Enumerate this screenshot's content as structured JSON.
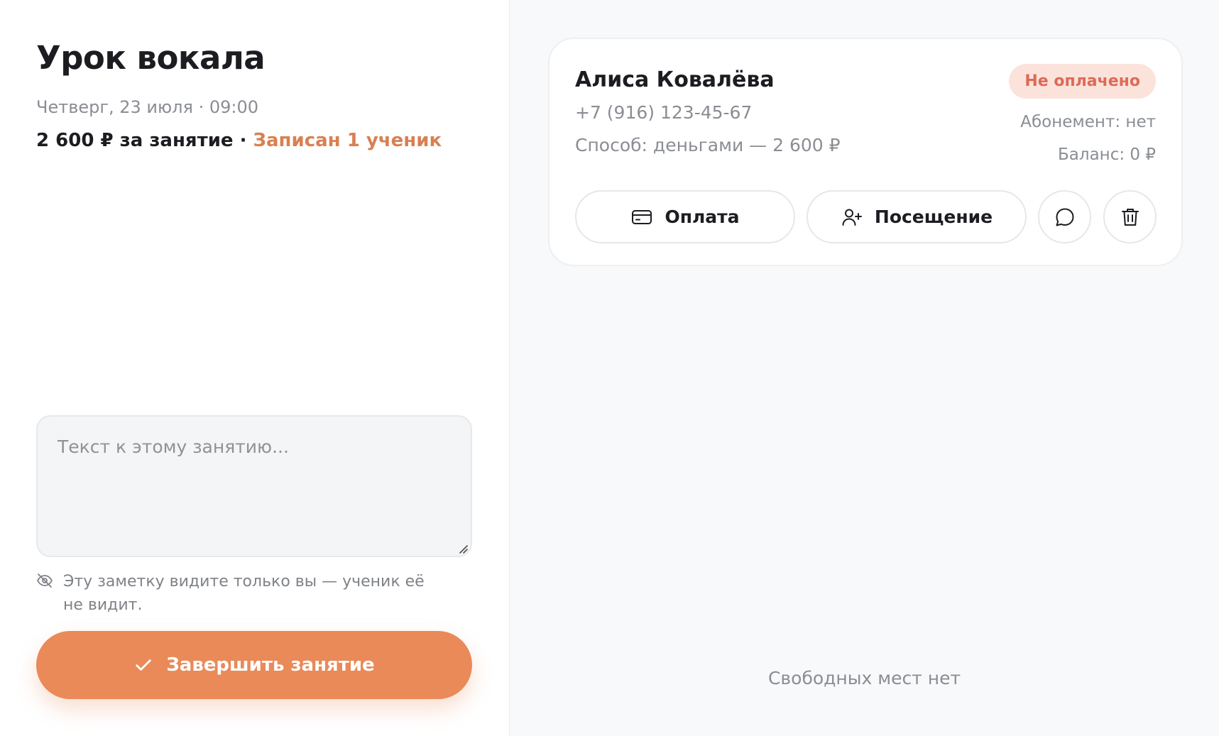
{
  "lesson": {
    "title": "Урок вокала",
    "subtitle": "Четверг, 23 июля · 09:00",
    "price": "2 600 ₽ за занятие",
    "separator": " · ",
    "enrolled": "Записан 1 ученик"
  },
  "note": {
    "value": "",
    "placeholder": "Текст к этому занятию...",
    "hint": "Эту заметку видите только вы — ученик её не видит."
  },
  "finish_button": {
    "label": "Завершить занятие",
    "icon": "check-icon"
  },
  "student_card": {
    "name": "Алиса Ковалёва",
    "phone": "+7 (916) 123-45-67",
    "method": "Способ: деньгами — 2 600 ₽",
    "status": "Не оплачено",
    "subscription": "Абонемент: нет",
    "balance": "Баланс: 0 ₽",
    "actions": {
      "pay_label": "Оплата",
      "pay_icon": "credit-card-icon",
      "visit_label": "Посещение",
      "visit_icon": "user-plus-icon",
      "chat_icon": "chat-bubble-icon",
      "delete_icon": "trash-icon"
    }
  },
  "footer": {
    "no_seats": "Свободных мест нет"
  },
  "colors": {
    "accent": "#e98a58",
    "accent_text": "#d98051",
    "status_bg": "#fbe3dc",
    "status_text": "#de6a56",
    "muted_text": "#8a8d93",
    "right_panel_bg": "#f8f9fa"
  }
}
